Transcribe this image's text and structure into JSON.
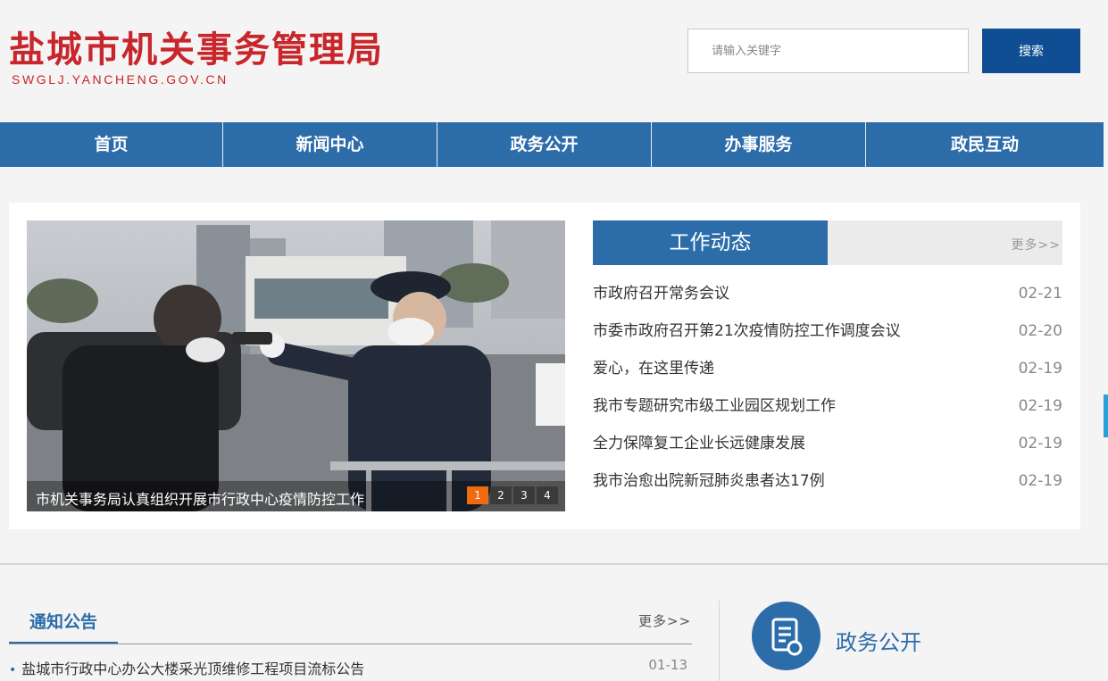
{
  "header": {
    "site_title": "盐城市机关事务管理局",
    "site_domain": "SWGLJ.YANCHENG.GOV.CN",
    "search_placeholder": "请输入关键字",
    "search_button": "搜索"
  },
  "nav": {
    "items": [
      {
        "label": "首页"
      },
      {
        "label": "新闻中心"
      },
      {
        "label": "政务公开"
      },
      {
        "label": "办事服务"
      },
      {
        "label": "政民互动"
      }
    ]
  },
  "slider": {
    "caption": "市机关事务局认真组织开展市行政中心疫情防控工作",
    "pages": [
      "1",
      "2",
      "3",
      "4"
    ],
    "active_page": "1"
  },
  "news": {
    "title": "工作动态",
    "more": "更多>>",
    "items": [
      {
        "title": "市政府召开常务会议",
        "date": "02-21"
      },
      {
        "title": "市委市政府召开第21次疫情防控工作调度会议",
        "date": "02-20"
      },
      {
        "title": "爱心，在这里传递",
        "date": "02-19"
      },
      {
        "title": "我市专题研究市级工业园区规划工作",
        "date": "02-19"
      },
      {
        "title": "全力保障复工企业长远健康发展",
        "date": "02-19"
      },
      {
        "title": "我市治愈出院新冠肺炎患者达17例",
        "date": "02-19"
      }
    ]
  },
  "notice": {
    "title": "通知公告",
    "more": "更多>>",
    "items": [
      {
        "title": "盐城市行政中心办公大楼采光顶维修工程项目流标公告",
        "date": "01-13"
      }
    ]
  },
  "gov_open": {
    "label": "政务公开",
    "icon": "document-check-icon"
  },
  "colors": {
    "brand_red": "#c8262b",
    "nav_blue": "#2c6ca9",
    "search_blue": "#104e93",
    "active_orange": "#f06a0f"
  }
}
